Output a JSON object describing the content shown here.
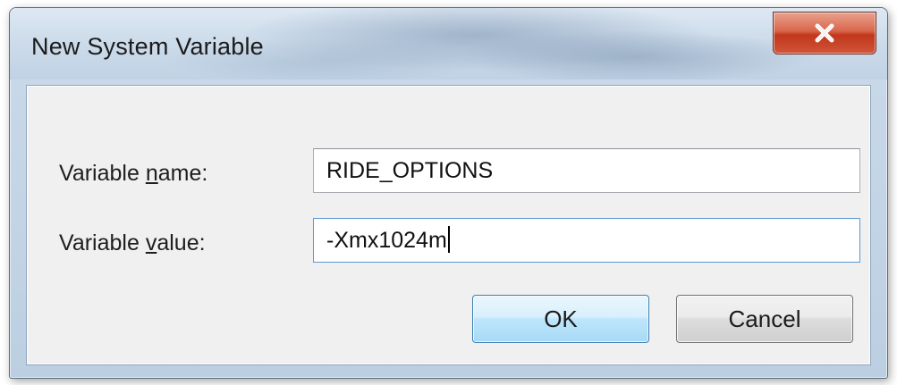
{
  "window": {
    "title": "New System Variable"
  },
  "form": {
    "name_label_pre": "Variable ",
    "name_label_accel": "n",
    "name_label_post": "ame:",
    "name_value": "RIDE_OPTIONS",
    "value_label_pre": "Variable ",
    "value_label_accel": "v",
    "value_label_post": "alue:",
    "value_value": "-Xmx1024m"
  },
  "buttons": {
    "ok_label": "OK",
    "cancel_label": "Cancel"
  },
  "colors": {
    "close_button": "#c9432a",
    "default_button_border": "#3c7fb1",
    "focused_field_border": "#5a99d6"
  }
}
